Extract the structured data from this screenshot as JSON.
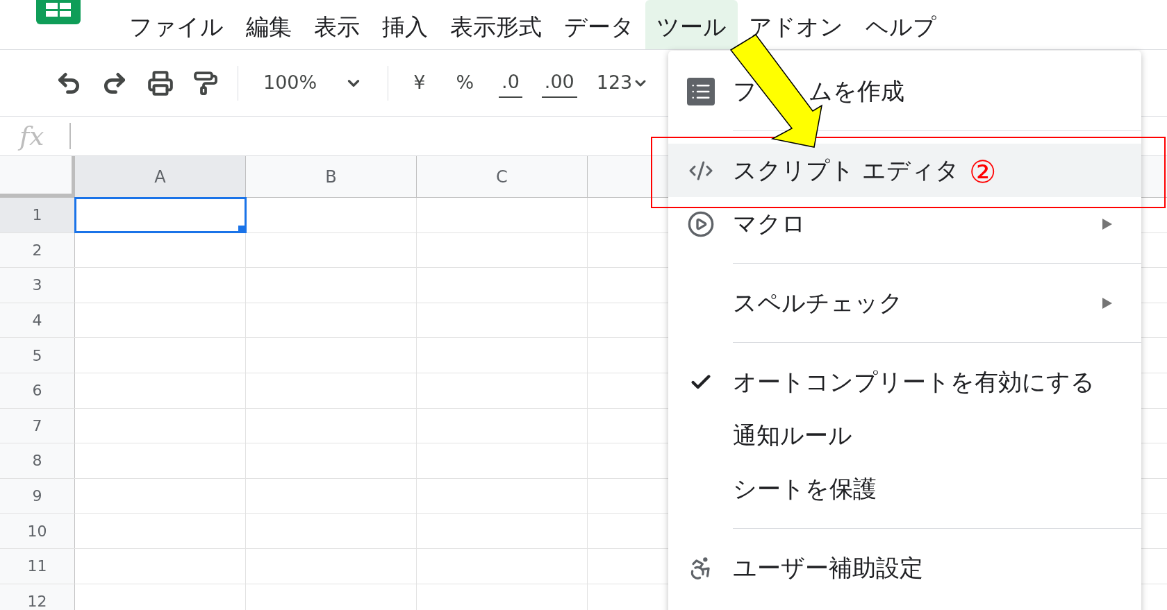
{
  "menu_bar": {
    "items": [
      {
        "label": "ファイル",
        "selected": false
      },
      {
        "label": "編集",
        "selected": false
      },
      {
        "label": "表示",
        "selected": false
      },
      {
        "label": "挿入",
        "selected": false
      },
      {
        "label": "表示形式",
        "selected": false
      },
      {
        "label": "データ",
        "selected": false
      },
      {
        "label": "ツール",
        "selected": true
      },
      {
        "label": "アドオン",
        "selected": false
      },
      {
        "label": "ヘルプ",
        "selected": false
      }
    ]
  },
  "toolbar": {
    "zoom": "100%",
    "currency": "¥",
    "percent": "%",
    "decrease_decimals": ".0",
    "increase_decimals": ".00",
    "more_formats": "123"
  },
  "formula_bar": {
    "label": "fx"
  },
  "sheet": {
    "columns": [
      {
        "label": "A",
        "selected": true
      },
      {
        "label": "B",
        "selected": false
      },
      {
        "label": "C",
        "selected": false
      }
    ],
    "rows": [
      {
        "label": "1",
        "selected": true
      },
      {
        "label": "2",
        "selected": false
      },
      {
        "label": "3",
        "selected": false
      },
      {
        "label": "4",
        "selected": false
      },
      {
        "label": "5",
        "selected": false
      },
      {
        "label": "6",
        "selected": false
      },
      {
        "label": "7",
        "selected": false
      },
      {
        "label": "8",
        "selected": false
      },
      {
        "label": "9",
        "selected": false
      },
      {
        "label": "10",
        "selected": false
      },
      {
        "label": "11",
        "selected": false
      },
      {
        "label": "12",
        "selected": false
      }
    ]
  },
  "tools_menu": {
    "items": [
      {
        "kind": "form",
        "label_start": "フ",
        "label": "ムを作成",
        "highlighted": false,
        "submenu": false,
        "checked": false
      },
      {
        "kind": "divider"
      },
      {
        "kind": "script",
        "label": "スクリプト エディタ",
        "highlighted": true,
        "submenu": false,
        "checked": false
      },
      {
        "kind": "macro",
        "label": "マクロ",
        "highlighted": false,
        "submenu": true,
        "checked": false
      },
      {
        "kind": "divider"
      },
      {
        "kind": "plain",
        "label": "スペルチェック",
        "highlighted": false,
        "submenu": true,
        "checked": false
      },
      {
        "kind": "divider"
      },
      {
        "kind": "plain",
        "label": "オートコンプリートを有効にする",
        "highlighted": false,
        "submenu": false,
        "checked": true
      },
      {
        "kind": "plain",
        "label": "通知ルール",
        "highlighted": false,
        "submenu": false,
        "checked": false
      },
      {
        "kind": "plain",
        "label": "シートを保護",
        "highlighted": false,
        "submenu": false,
        "checked": false
      },
      {
        "kind": "divider"
      },
      {
        "kind": "accessibility",
        "label": "ユーザー補助設定",
        "highlighted": false,
        "submenu": false,
        "checked": false
      }
    ]
  },
  "annotation": {
    "step": "②"
  }
}
